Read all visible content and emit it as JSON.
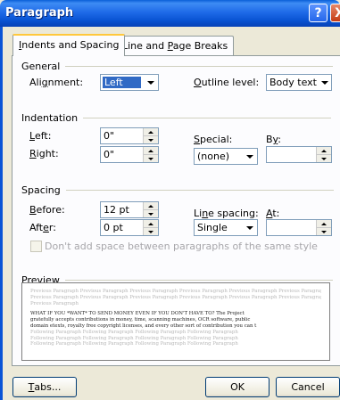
{
  "dialog": {
    "title": "Paragraph"
  },
  "titlebar": {
    "help_glyph": "?",
    "close_glyph": "X"
  },
  "tabs": [
    {
      "label": "Indents and Spacing",
      "accel": "I",
      "rest": "ndents and Spacing",
      "active": true
    },
    {
      "label": "Line and Page Breaks",
      "pre": "Line and ",
      "accel": "P",
      "rest": "age Breaks",
      "active": false
    }
  ],
  "general": {
    "header": "General",
    "alignment": {
      "label": "Alignment:",
      "pre": "Ali",
      "accel": "g",
      "rest": "nment:",
      "value": "Left"
    },
    "outline": {
      "label": "Outline level:",
      "accel": "O",
      "rest": "utline level:",
      "value": "Body text"
    }
  },
  "indentation": {
    "header": "Indentation",
    "left": {
      "label": "Left:",
      "accel": "L",
      "rest": "eft:",
      "value": "0\""
    },
    "right": {
      "label": "Right:",
      "accel": "R",
      "rest": "ight:",
      "value": "0\""
    },
    "special": {
      "label": "Special:",
      "accel": "S",
      "rest": "pecial:",
      "value": "(none)"
    },
    "by": {
      "label": "By:",
      "pre": "B",
      "accel": "y",
      "rest": ":",
      "value": ""
    }
  },
  "spacing": {
    "header": "Spacing",
    "before": {
      "label": "Before:",
      "accel": "B",
      "rest": "efore:",
      "value": "12 pt"
    },
    "after": {
      "label": "After:",
      "pre": "Aft",
      "accel": "e",
      "rest": "r:",
      "value": "0 pt"
    },
    "line_spacing": {
      "label": "Line spacing:",
      "pre": "Li",
      "accel": "n",
      "rest": "e spacing:",
      "value": "Single"
    },
    "at": {
      "label": "At:",
      "accel": "A",
      "rest": "t:",
      "value": ""
    },
    "no_space_same_style": {
      "label": "Don't add space between paragraphs of the same style",
      "checked": false,
      "enabled": false
    }
  },
  "preview": {
    "header": "Preview",
    "prev_lines": [
      "Previous Paragraph Previous Paragraph Previous Paragraph Previous Paragraph Previous Paragraph Previous Paragraph",
      "Previous Paragraph Previous Paragraph Previous Paragraph Previous Paragraph Previous Paragraph Previous Paragraph",
      "Previous Paragraph"
    ],
    "body_lines": [
      "WHAT IF YOU *WANT* TO SEND MONEY EVEN IF YOU DON'T HAVE TO? The Project",
      "gratefully accepts contributions in money, time, scanning machines, OCR software, public",
      "domain etexts, royalty free copyright licenses, and every other sort of contribution you can t"
    ],
    "next_lines": [
      "Following Paragraph Following Paragraph Following Paragraph Following Paragraph",
      "Following Paragraph Following Paragraph Following Paragraph Following Paragraph",
      "Following Paragraph Following Paragraph Following Paragraph Following Paragraph"
    ]
  },
  "buttons": {
    "tabs": {
      "label": "Tabs...",
      "accel": "T",
      "rest": "abs..."
    },
    "ok": {
      "label": "OK"
    },
    "cancel": {
      "label": "Cancel"
    }
  },
  "colors": {
    "titlebar": "#0a54d4",
    "dialog_bg": "#ece9d8",
    "selection": "#316ac5",
    "tab_highlight": "#ffc83c"
  }
}
